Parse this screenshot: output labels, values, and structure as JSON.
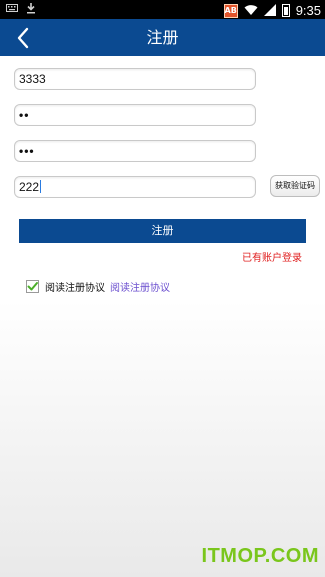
{
  "status_bar": {
    "left_icons": [
      "keyboard-icon",
      "download-icon"
    ],
    "ab_badge": "AB",
    "time": "9:35"
  },
  "header": {
    "title": "注册",
    "back_icon": "chevron-left-icon"
  },
  "form": {
    "phone_value": "3333",
    "password_value": "••",
    "confirm_password_value": "•••",
    "code_value": "222",
    "get_code_label": "获取验证码",
    "submit_label": "注册",
    "login_link": "已有账户登录",
    "agree_checked": true,
    "agree_label": "阅读注册协议",
    "agreement_link": "阅读注册协议"
  },
  "watermark": "ITMOP.COM",
  "colors": {
    "primary": "#0b4a91",
    "link_red": "#e02020",
    "link_purple": "#6b4fcf",
    "check_green": "#4caf2a"
  }
}
